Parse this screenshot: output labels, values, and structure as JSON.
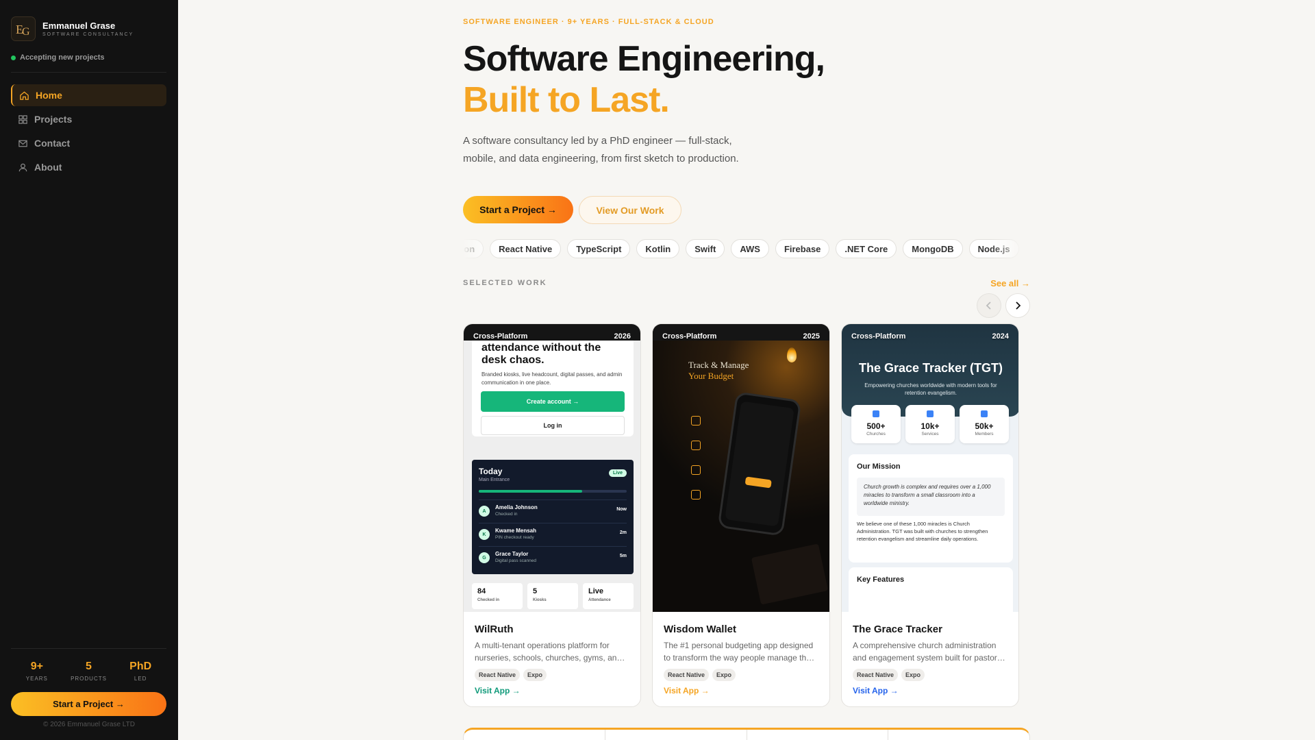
{
  "sidebar": {
    "brand_name": "Emmanuel Grase",
    "brand_sub": "SOFTWARE CONSULTANCY",
    "availability": "Accepting new projects",
    "nav": [
      {
        "label": "Home",
        "icon": "home-icon"
      },
      {
        "label": "Projects",
        "icon": "grid-icon"
      },
      {
        "label": "Contact",
        "icon": "mail-icon"
      },
      {
        "label": "About",
        "icon": "user-icon"
      }
    ],
    "stats": [
      {
        "value": "9+",
        "label": "YEARS"
      },
      {
        "value": "5",
        "label": "PRODUCTS"
      },
      {
        "value": "PhD",
        "label": "LED"
      }
    ],
    "cta": "Start a Project →",
    "copyright": "© 2026 Emmanuel Grase LTD"
  },
  "hero": {
    "eyebrow": "SOFTWARE ENGINEER · 9+ YEARS · FULL-STACK & CLOUD",
    "title_line1": "Software Engineering,",
    "title_line2": "Built to Last.",
    "lead": "A software consultancy led by a PhD engineer — full-stack, mobile, and data engineering, from first sketch to production.",
    "primary_cta": "Start a Project →",
    "secondary_cta": "View Our Work",
    "tech": [
      "thon",
      "React Native",
      "TypeScript",
      "Kotlin",
      "Swift",
      "AWS",
      "Firebase",
      ".NET Core",
      "MongoDB",
      "Node.js"
    ]
  },
  "work": {
    "label": "SELECTED WORK",
    "see_all": "See all →",
    "cards": [
      {
        "category": "Cross-Platform",
        "year": "2026",
        "title": "WilRuth",
        "description": "A multi-tenant operations platform for nurseries, schools, churches, gyms, an…",
        "tags": [
          "React Native",
          "Expo"
        ],
        "visit": "Visit App →",
        "visit_color": "#0f9a7a",
        "screen": {
          "heading": "attendance without the desk chaos.",
          "paragraph": "Branded kiosks, live headcount, digital passes, and admin communication in one place.",
          "create": "Create account",
          "login": "Log in",
          "today": "Today",
          "today_sub": "Main Entrance",
          "live": "Live",
          "progress": 0.7,
          "rows": [
            {
              "initial": "A",
              "name": "Amelia Johnson",
              "sub": "Checked in",
              "time": "Now"
            },
            {
              "initial": "K",
              "name": "Kwame Mensah",
              "sub": "PIN checkout ready",
              "time": "2m"
            },
            {
              "initial": "G",
              "name": "Grace Taylor",
              "sub": "Digital pass scanned",
              "time": "5m"
            }
          ],
          "minis": [
            {
              "value": "84",
              "label": "Checked in"
            },
            {
              "value": "5",
              "label": "Kiosks"
            },
            {
              "value": "Live",
              "label": "Attendance"
            }
          ]
        }
      },
      {
        "category": "Cross-Platform",
        "year": "2025",
        "title": "Wisdom Wallet",
        "description": "The #1 personal budgeting app designed to transform the way people manage th…",
        "tags": [
          "React Native",
          "Expo"
        ],
        "visit": "Visit App →",
        "visit_color": "#f5a524",
        "screen": {
          "line1": "Track & Manage",
          "line2": "Your Budget"
        }
      },
      {
        "category": "Cross-Platform",
        "year": "2024",
        "title": "The Grace Tracker",
        "description": "A comprehensive church administration and engagement system built for pastor…",
        "tags": [
          "React Native",
          "Expo"
        ],
        "visit": "Visit App →",
        "visit_color": "#2563eb",
        "screen": {
          "title": "The Grace Tracker (TGT)",
          "subtitle": "Empowering churches worldwide with modern tools for retention evangelism.",
          "stats": [
            {
              "value": "500+",
              "label": "Churches"
            },
            {
              "value": "10k+",
              "label": "Services"
            },
            {
              "value": "50k+",
              "label": "Members"
            }
          ],
          "mission_title": "Our Mission",
          "quote": "Church growth is complex and requires over a 1,000 miracles to transform a small classroom into a worldwide ministry.",
          "mission_text": "We believe one of these 1,000 miracles is Church Administration. TGT was built with churches to strengthen retention evangelism and streamline daily operations.",
          "features_title": "Key Features"
        }
      }
    ]
  },
  "colors": {
    "accent": "#f5a524",
    "sidebar_bg": "#121212",
    "page_bg": "#f7f6f3",
    "status_green": "#22c55e"
  }
}
